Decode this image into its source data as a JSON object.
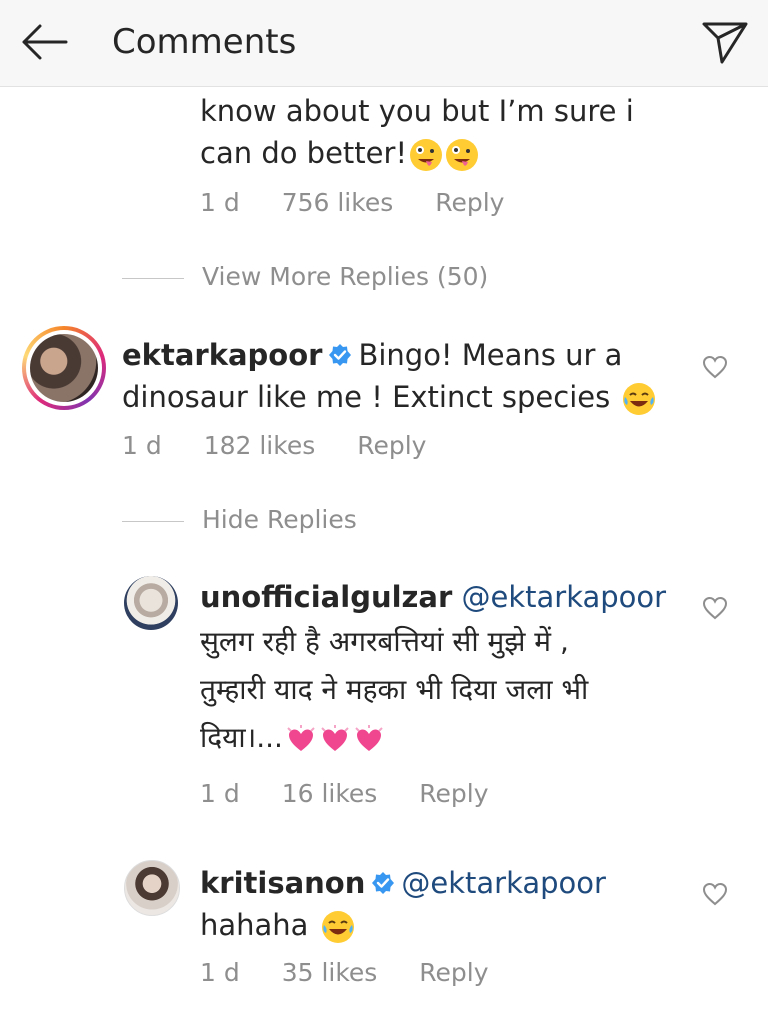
{
  "header": {
    "title": "Comments"
  },
  "comment0": {
    "text_line1": "know about you but I’m sure i",
    "text_line2": "can do better!",
    "time": "1 d",
    "likes": "756 likes",
    "reply": "Reply"
  },
  "view_more": "View More Replies (50)",
  "comment1": {
    "username": "ektarkapoor",
    "text_part1": "Bingo! Means ur a",
    "text_line2": "dinosaur like me ! Extinct species",
    "time": "1 d",
    "likes": "182 likes",
    "reply": "Reply"
  },
  "hide_replies": "Hide Replies",
  "reply1": {
    "username": "unofficialgulzar",
    "mention": "@ektarkapoor",
    "line1": "सुलग रही है अगरबत्तियां सी मुझे में ,",
    "line2": "तुम्हारी याद ने महका भी दिया जला भी",
    "line3": "दिया।...",
    "time": "1 d",
    "likes": "16 likes",
    "reply": "Reply"
  },
  "reply2": {
    "username": "kritisanon",
    "mention": "@ektarkapoor",
    "text": "hahaha",
    "time": "1 d",
    "likes": "35 likes",
    "reply": "Reply"
  },
  "colors": {
    "mention": "#1e4a7d",
    "meta": "#8e8e8e",
    "verified": "#3897f0"
  },
  "icons": [
    "back-arrow-icon",
    "send-icon",
    "heart-icon",
    "verified-icon",
    "emoji"
  ]
}
